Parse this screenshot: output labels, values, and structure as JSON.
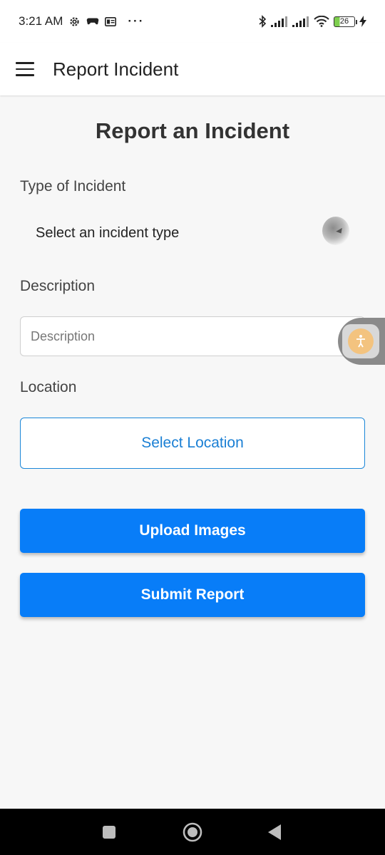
{
  "status_bar": {
    "time": "3:21 AM",
    "battery_level": "26",
    "icons": [
      "settings-gear-icon",
      "gamepad-icon",
      "id-card-icon",
      "bluetooth-icon",
      "signal-icon",
      "signal-icon",
      "wifi-icon",
      "battery-icon",
      "charging-bolt-icon"
    ],
    "more": "···"
  },
  "app_bar": {
    "title": "Report Incident",
    "menu_icon": "hamburger-menu-icon"
  },
  "form": {
    "heading": "Report an Incident",
    "incident_type": {
      "label": "Type of Incident",
      "selected": "Select an incident type"
    },
    "description": {
      "label": "Description",
      "placeholder": "Description",
      "value": ""
    },
    "location": {
      "label": "Location",
      "button_label": "Select Location"
    },
    "upload_button": "Upload Images",
    "submit_button": "Submit Report"
  },
  "colors": {
    "primary": "#087df8",
    "outline": "#1a86d8",
    "background": "#f7f7f7"
  },
  "nav_bar": {
    "icons": [
      "recents-square-icon",
      "home-circle-icon",
      "back-triangle-icon"
    ]
  }
}
